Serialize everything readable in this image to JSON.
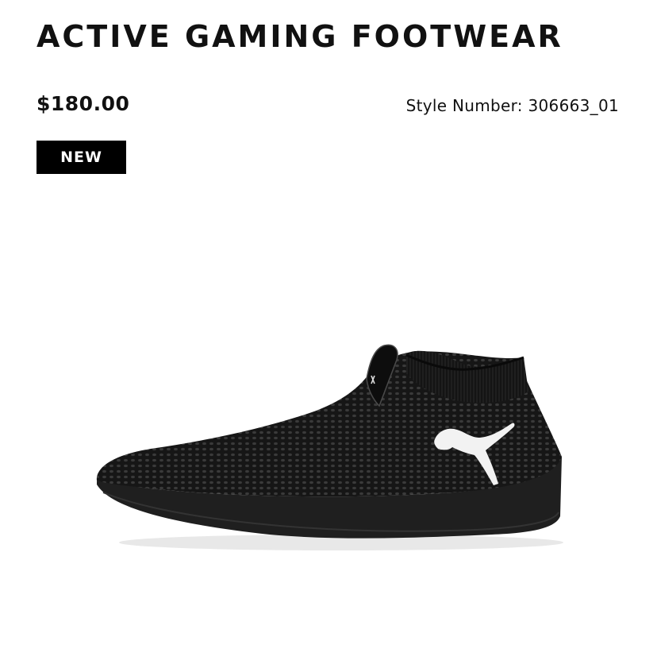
{
  "product": {
    "title": "ACTIVE GAMING FOOTWEAR",
    "price": "$180.00",
    "style_number": "Style Number: 306663_01",
    "badge": "NEW"
  },
  "colors": {
    "text": "#111111",
    "badge_bg": "#000000",
    "badge_text": "#ffffff",
    "shoe": "#121212",
    "logo": "#f2f2f2"
  },
  "image": {
    "icon": "black-knit-slip-on-shoe"
  }
}
